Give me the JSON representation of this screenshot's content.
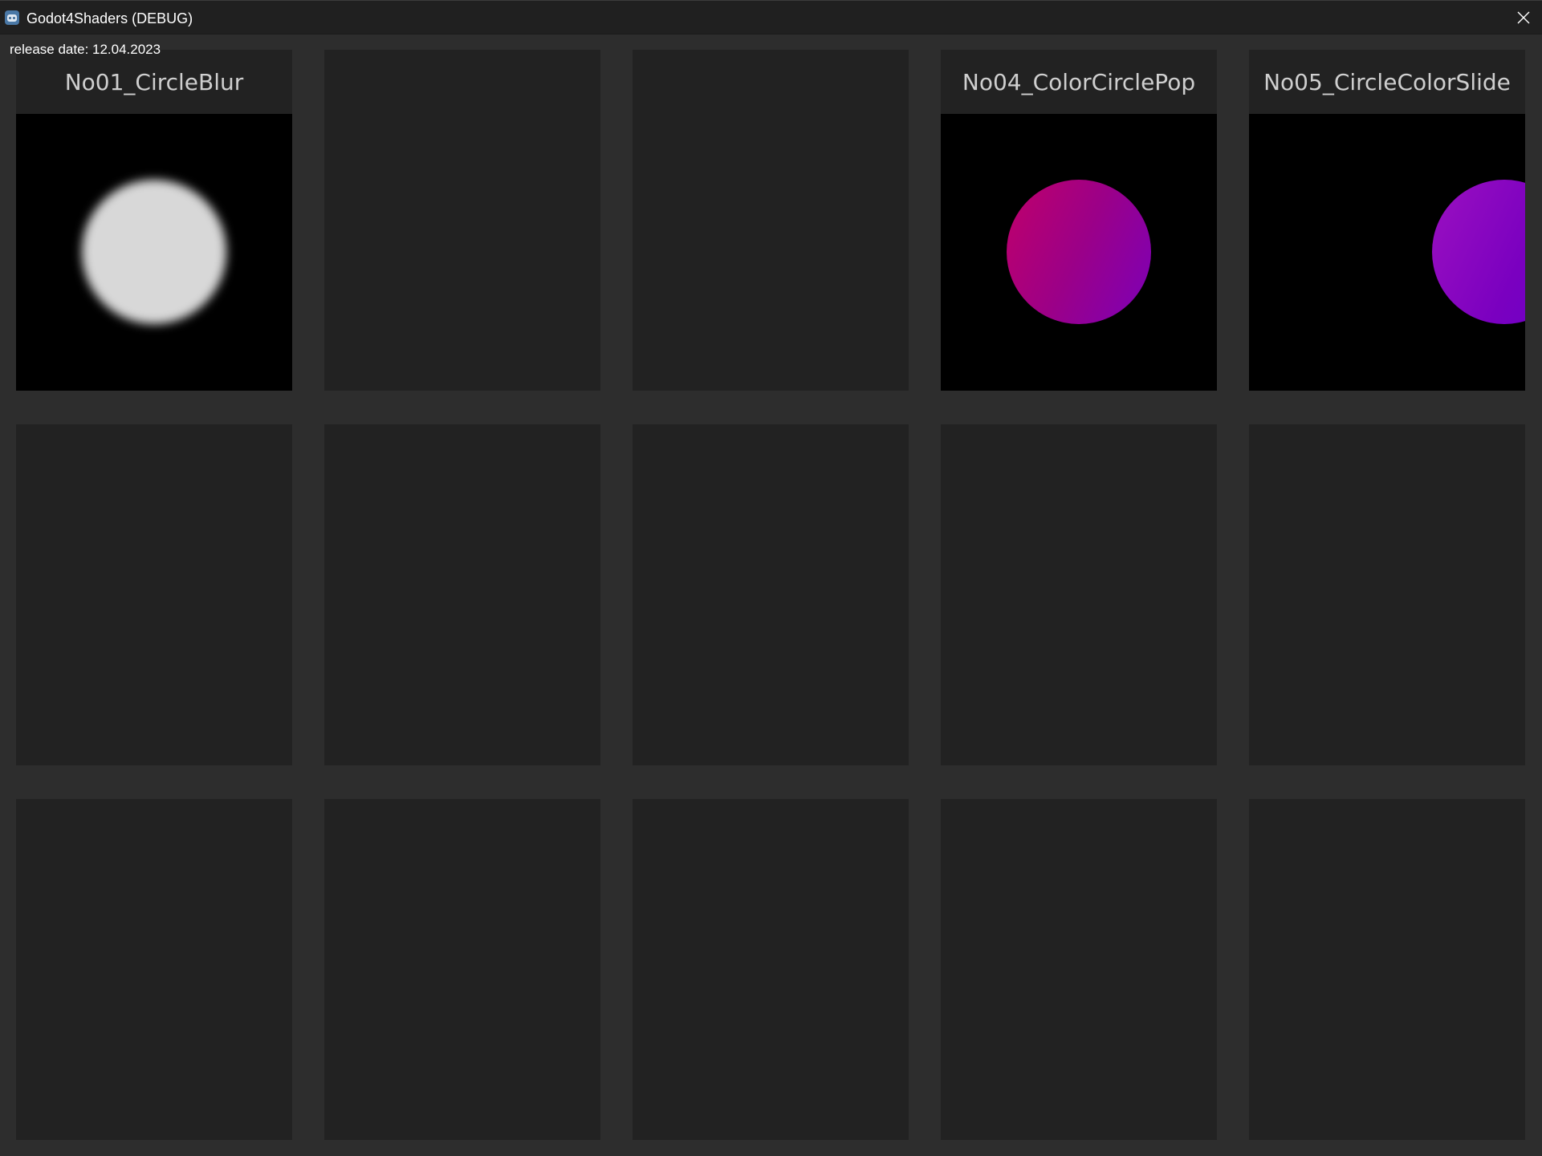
{
  "window": {
    "title": "Godot4Shaders (DEBUG)",
    "close_icon": "close-icon"
  },
  "release_date": "release date: 12.04.2023",
  "colors": {
    "background": "#2d2d2d",
    "card": "#222222",
    "title_text": "#cfcfcf",
    "circle_blur": "#d8d8d8",
    "pop_gradient": [
      "#c0006a",
      "#7c00b8"
    ],
    "slide_gradient": [
      "#9b10c0",
      "#6a00c8"
    ]
  },
  "cards": [
    {
      "label": "No01_CircleBlur",
      "preview": "blurred-white-circle"
    },
    {
      "label": "",
      "preview": "none"
    },
    {
      "label": "",
      "preview": "none"
    },
    {
      "label": "No04_ColorCirclePop",
      "preview": "magenta-purple-gradient-circle"
    },
    {
      "label": "No05_CircleColorSlide",
      "preview": "purple-circle-partially-visible"
    },
    {
      "label": "",
      "preview": "none"
    },
    {
      "label": "",
      "preview": "none"
    },
    {
      "label": "",
      "preview": "none"
    },
    {
      "label": "",
      "preview": "none"
    },
    {
      "label": "",
      "preview": "none"
    },
    {
      "label": "",
      "preview": "none"
    },
    {
      "label": "",
      "preview": "none"
    },
    {
      "label": "",
      "preview": "none"
    },
    {
      "label": "",
      "preview": "none"
    },
    {
      "label": "",
      "preview": "none"
    }
  ]
}
